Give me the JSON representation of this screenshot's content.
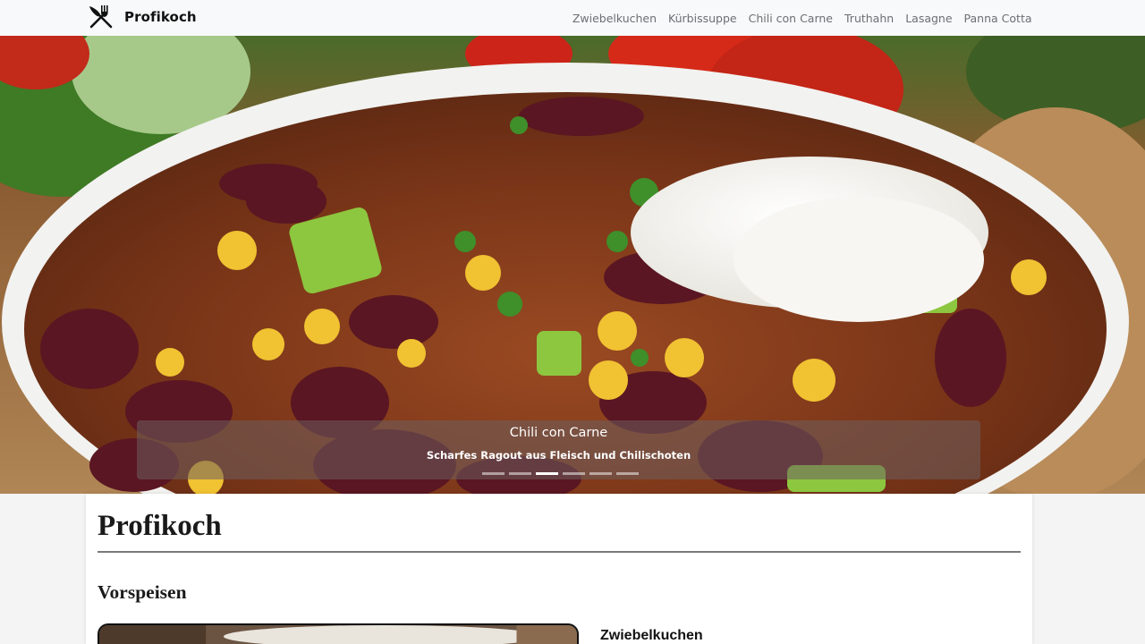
{
  "navbar": {
    "brand_text": "Profikoch",
    "brand_icon": "fork-knife-icon",
    "links": [
      {
        "label": "Zwiebelkuchen"
      },
      {
        "label": "Kürbissuppe"
      },
      {
        "label": "Chili con Carne"
      },
      {
        "label": "Truthahn"
      },
      {
        "label": "Lasagne"
      },
      {
        "label": "Panna Cotta"
      }
    ]
  },
  "carousel": {
    "caption_title": "Chili con Carne",
    "caption_subtitle": "Scharfes Ragout aus Fleisch und Chilischoten",
    "slide_count": 6,
    "active_index": 2
  },
  "main": {
    "page_title": "Profikoch",
    "section_title": "Vorspeisen",
    "first_card_title": "Zwiebelkuchen"
  },
  "colors": {
    "navbar_bg": "#f8f9fa",
    "nav_link": "#6c6f73",
    "page_bg": "#f4f4f4",
    "content_bg": "#ffffff"
  }
}
